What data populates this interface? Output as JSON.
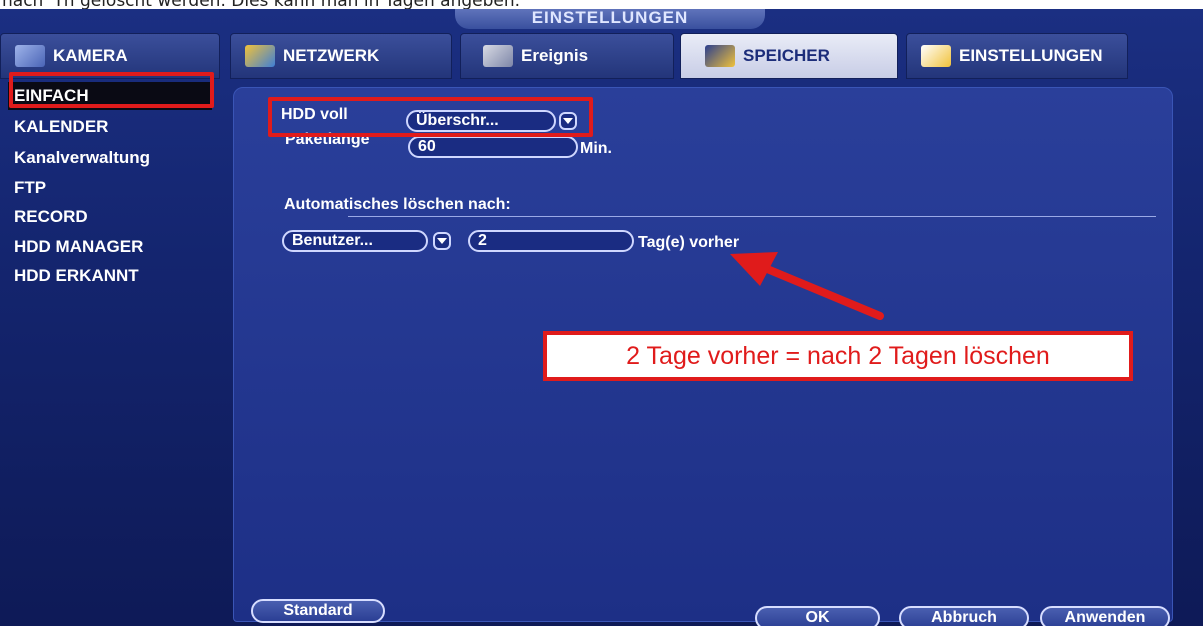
{
  "doc": {
    "top_text": "nach 'Tn gelöscht werden. Dies kann man in Tagen angeben."
  },
  "header": {
    "title": "EINSTELLUNGEN"
  },
  "tabs": [
    {
      "label": "KAMERA",
      "icon": "camera-icon"
    },
    {
      "label": "NETZWERK",
      "icon": "network-icon"
    },
    {
      "label": "Ereignis",
      "icon": "event-icon"
    },
    {
      "label": "SPEICHER",
      "icon": "storage-icon"
    },
    {
      "label": "EINSTELLUNGEN",
      "icon": "settings-icon"
    }
  ],
  "active_tab": "SPEICHER",
  "sidebar": {
    "items": [
      {
        "label": "EINFACH"
      },
      {
        "label": "KALENDER"
      },
      {
        "label": "Kanalverwaltung"
      },
      {
        "label": "FTP"
      },
      {
        "label": "RECORD"
      },
      {
        "label": "HDD MANAGER"
      },
      {
        "label": "HDD ERKANNT"
      }
    ],
    "active": "EINFACH"
  },
  "form": {
    "hdd_voll_label": "HDD voll",
    "hdd_voll_value": "Überschr...",
    "paketlaenge_label": "Paketlänge",
    "paketlaenge_value": "60",
    "paketlaenge_unit": "Min.",
    "auto_delete_label": "Automatisches löschen nach:",
    "auto_delete_mode": "Benutzer...",
    "auto_delete_days": "2",
    "auto_delete_unit": "Tag(e) vorher"
  },
  "annotation": {
    "callout_text": "2 Tage vorher = nach 2 Tagen löschen"
  },
  "footer": {
    "standard": "Standard",
    "ok": "OK",
    "abbruch": "Abbruch",
    "anwenden": "Anwenden"
  },
  "colors": {
    "accent_red": "#e01b1b",
    "panel_blue": "#1d2f86",
    "active_tab_bg": "#e9ecf7"
  }
}
